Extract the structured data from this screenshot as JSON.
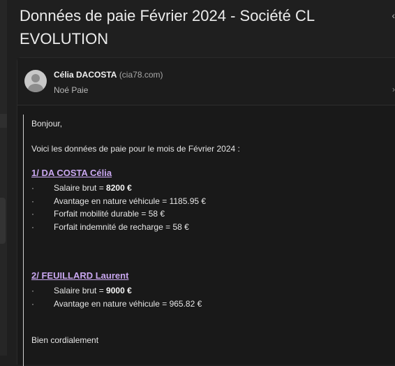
{
  "subject": "Données de paie Février 2024 - Société CL EVOLUTION",
  "sender": {
    "name": "Célia DACOSTA",
    "domain": "(cia78.com)"
  },
  "recipient": "Noé Paie",
  "message": {
    "greeting": "Bonjour,",
    "intro": "Voici les données de paie pour le mois de Février 2024 :",
    "sections": [
      {
        "title": "1/ DA COSTA Célia",
        "items": [
          {
            "label": "Salaire brut = ",
            "value": "8200 €",
            "bold": true
          },
          {
            "label": "Avantage en nature véhicule = ",
            "value": "1185.95 €",
            "bold": false
          },
          {
            "label": "Forfait mobilité durable = ",
            "value": "58 €",
            "bold": false
          },
          {
            "label": "Forfait indemnité de recharge = ",
            "value": "58 €",
            "bold": false
          }
        ]
      },
      {
        "title": "2/ FEUILLARD Laurent",
        "items": [
          {
            "label": "Salaire brut = ",
            "value": "9000 €",
            "bold": true
          },
          {
            "label": "Avantage en nature véhicule = ",
            "value": "965.82 €",
            "bold": false
          }
        ]
      }
    ],
    "bullet": "·",
    "closing": "Bien cordialement"
  },
  "icons": {
    "avatar": "avatar-placeholder-icon",
    "chevron": "chevron-right-icon"
  },
  "colors": {
    "background": "#1f1f1f",
    "card": "#191919",
    "link": "#c9a7f0"
  }
}
